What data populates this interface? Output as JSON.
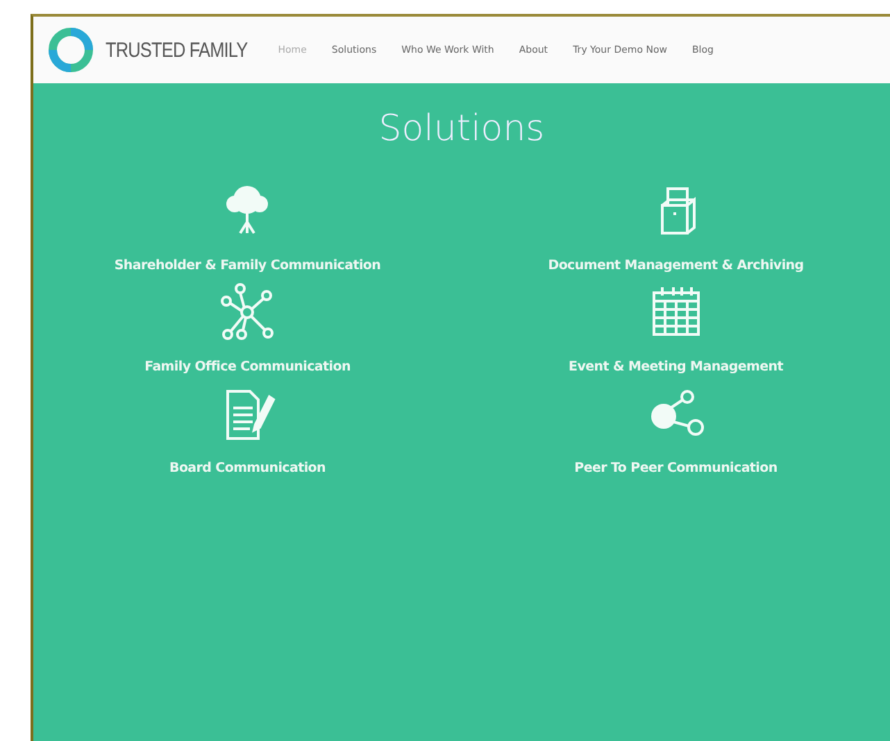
{
  "brand": {
    "name": "TRUSTED FAMILY"
  },
  "nav": [
    {
      "label": "Home",
      "selected": true
    },
    {
      "label": "Solutions",
      "selected": false
    },
    {
      "label": "Who We Work With",
      "selected": false
    },
    {
      "label": "About",
      "selected": false
    },
    {
      "label": "Try Your Demo Now",
      "selected": false
    },
    {
      "label": "Blog",
      "selected": false
    }
  ],
  "heading": "Solutions",
  "solutions": [
    {
      "kind": "tree",
      "label": "Shareholder & Family Communication"
    },
    {
      "kind": "box",
      "label": "Document Management & Archiving"
    },
    {
      "kind": "network",
      "label": "Family Office Communication"
    },
    {
      "kind": "calendar",
      "label": "Event & Meeting Management"
    },
    {
      "kind": "document",
      "label": "Board Communication"
    },
    {
      "kind": "peers",
      "label": "Peer To Peer Communication"
    }
  ]
}
